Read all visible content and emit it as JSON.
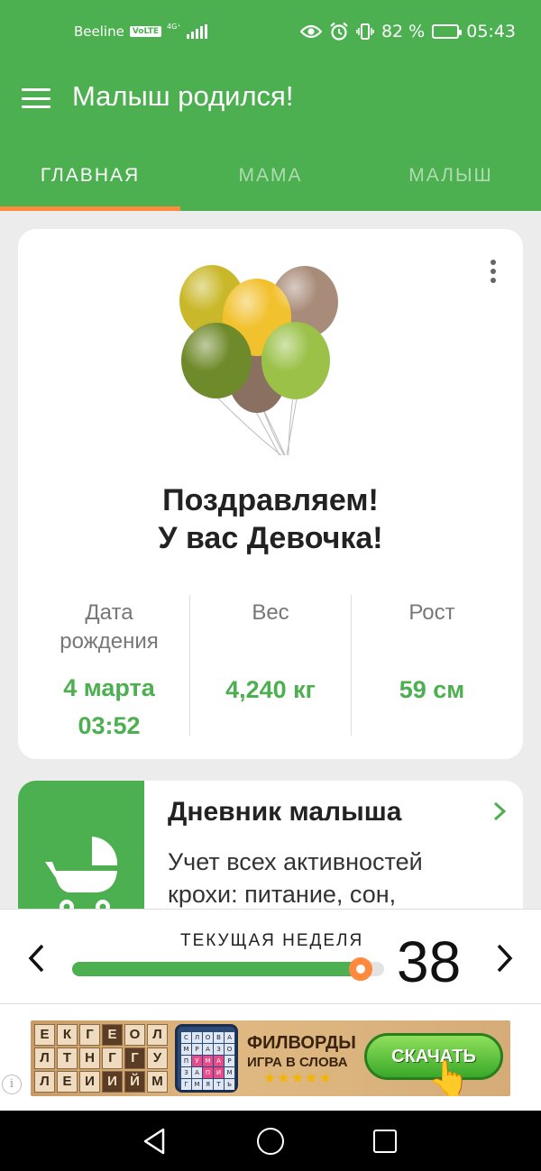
{
  "status_bar": {
    "carrier": "Beeline",
    "volte": "VoLTE",
    "network": "4G⁺",
    "battery_percent": "82 %",
    "battery_level": 0.82,
    "time": "05:43",
    "icons": [
      "eye-icon",
      "alarm-icon",
      "vibrate-icon",
      "battery-icon"
    ]
  },
  "app_bar": {
    "title": "Малыш родился!",
    "menu_icon": "hamburger-menu-icon"
  },
  "tabs": [
    {
      "label": "ГЛАВНАЯ",
      "active": true
    },
    {
      "label": "МАМА",
      "active": false
    },
    {
      "label": "МАЛЫШ",
      "active": false
    }
  ],
  "hero": {
    "line1": "Поздравляем!",
    "line2": "У вас Девочка!",
    "stats": [
      {
        "label_line1": "Дата",
        "label_line2": "рождения",
        "value_line1": "4 марта",
        "value_line2": "03:52"
      },
      {
        "label_line1": "Вес",
        "label_line2": "",
        "value_line1": "4,240 кг",
        "value_line2": ""
      },
      {
        "label_line1": "Рост",
        "label_line2": "",
        "value_line1": "59 см",
        "value_line2": ""
      }
    ],
    "balloon_colors": [
      "#c9b829",
      "#f2c12e",
      "#a88b78",
      "#6f8a2a",
      "#9bc148",
      "#8a7060"
    ]
  },
  "diary": {
    "title": "Дневник малыша",
    "text_line1": "Учет всех активностей",
    "text_line2": "крохи: питание, сон,"
  },
  "week": {
    "label": "ТЕКУЩАЯ НЕДЕЛЯ",
    "number": "38",
    "progress_fraction": 0.925
  },
  "ad": {
    "info": "i",
    "grid": [
      "Е",
      "К",
      "Г",
      "Е",
      "О",
      "Л",
      "Л",
      "Т",
      "Н",
      "Г",
      "Г",
      "У",
      "Л",
      "Е",
      "И",
      "И",
      "Й",
      "М"
    ],
    "dark_cells": [
      3,
      10,
      15,
      16
    ],
    "phone_grid": [
      "С",
      "Л",
      "О",
      "В",
      "А",
      "М",
      "Р",
      "А",
      "З",
      "О",
      "П",
      "У",
      "М",
      "А",
      "Р",
      "З",
      "А",
      "П",
      "И",
      "М",
      "Г",
      "М",
      "Я",
      "Т",
      "Ь"
    ],
    "phone_hl": [
      11,
      12,
      13,
      17,
      18
    ],
    "title": "ФИЛВОРДЫ",
    "subtitle": "ИГРА В СЛОВА",
    "stars": "★★★★★",
    "cta": "СКАЧАТЬ"
  },
  "colors": {
    "primary": "#4caf50",
    "accent": "#ff8a3d",
    "background": "#ececec"
  }
}
